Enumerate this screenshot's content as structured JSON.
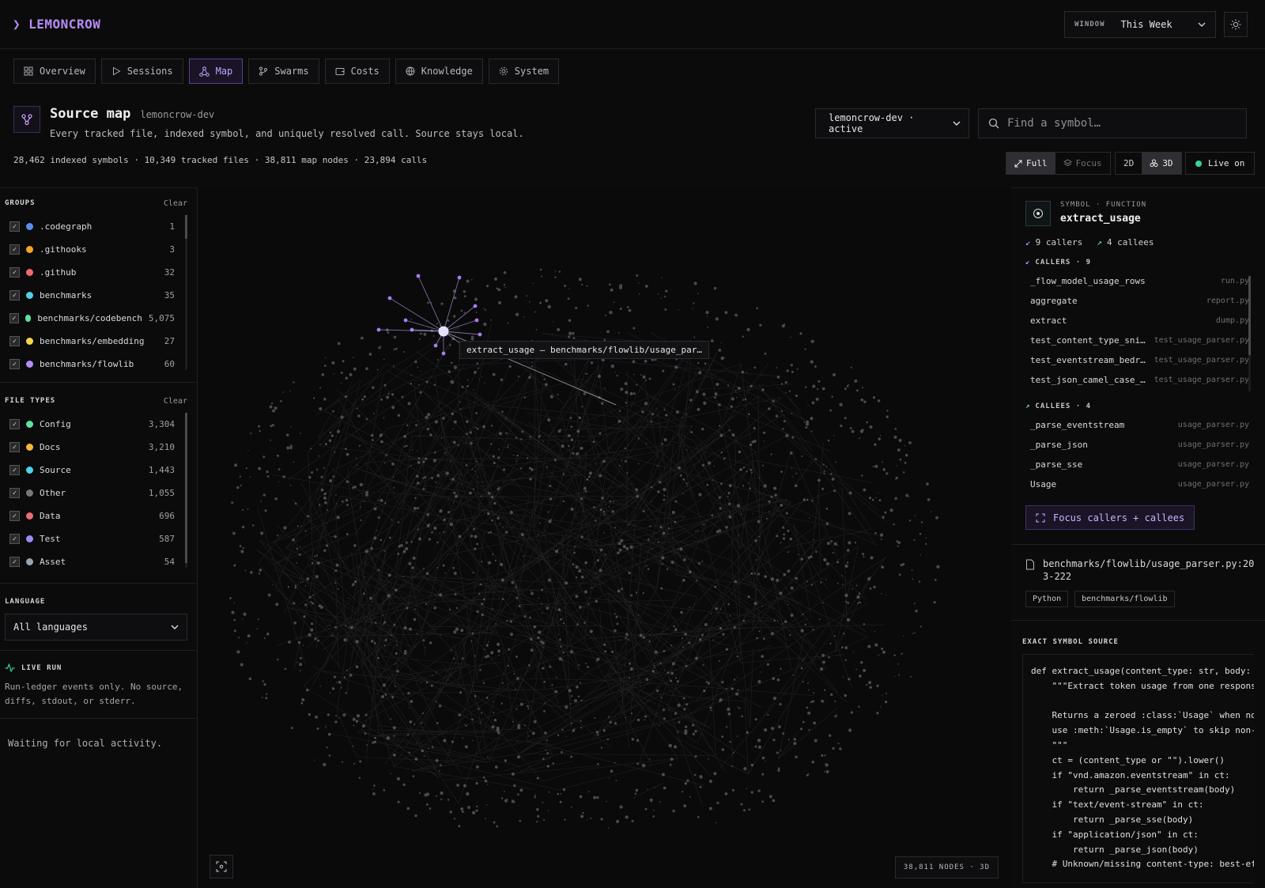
{
  "app": {
    "brand": "LEMONCROW"
  },
  "window": {
    "label": "WINDOW",
    "value": "This Week"
  },
  "tabs": [
    {
      "label": "Overview",
      "icon": "grid-icon"
    },
    {
      "label": "Sessions",
      "icon": "play-icon"
    },
    {
      "label": "Map",
      "icon": "graph-icon",
      "active": true
    },
    {
      "label": "Swarms",
      "icon": "branch-icon"
    },
    {
      "label": "Costs",
      "icon": "wallet-icon"
    },
    {
      "label": "Knowledge",
      "icon": "globe-icon"
    },
    {
      "label": "System",
      "icon": "gear-icon"
    }
  ],
  "header": {
    "title": "Source map",
    "project": "lemoncrow-dev",
    "description": "Every tracked file, indexed symbol, and uniquely resolved call. Source stays local.",
    "stats": "28,462 indexed symbols · 10,349 tracked files · 38,811 map nodes · 23,894 calls"
  },
  "project_select": {
    "value": "lemoncrow-dev · active"
  },
  "search": {
    "placeholder": "Find a symbol…"
  },
  "view": {
    "full": "Full",
    "focus": "Focus",
    "d2": "2D",
    "d3": "3D",
    "live": "Live on"
  },
  "groups": {
    "title": "GROUPS",
    "clear": "Clear",
    "items": [
      {
        "name": ".codegraph",
        "count": "1",
        "color": "#5b8def"
      },
      {
        "name": ".githooks",
        "count": "3",
        "color": "#f5a524"
      },
      {
        "name": ".github",
        "count": "32",
        "color": "#f06a6a"
      },
      {
        "name": "benchmarks",
        "count": "35",
        "color": "#4fd1e8"
      },
      {
        "name": "benchmarks/codebench",
        "count": "5,075",
        "color": "#5be39b"
      },
      {
        "name": "benchmarks/embedding",
        "count": "27",
        "color": "#f5d64a"
      },
      {
        "name": "benchmarks/flowlib",
        "count": "60",
        "color": "#b48df5"
      }
    ]
  },
  "file_types": {
    "title": "FILE TYPES",
    "clear": "Clear",
    "items": [
      {
        "name": "Config",
        "count": "3,304",
        "color": "#5be39b"
      },
      {
        "name": "Docs",
        "count": "3,210",
        "color": "#f5b83a"
      },
      {
        "name": "Source",
        "count": "1,443",
        "color": "#4fd1e8"
      },
      {
        "name": "Other",
        "count": "1,055",
        "color": "#777777"
      },
      {
        "name": "Data",
        "count": "696",
        "color": "#f06a7a"
      },
      {
        "name": "Test",
        "count": "587",
        "color": "#9a8cf5"
      },
      {
        "name": "Asset",
        "count": "54",
        "color": "#9aa4b0"
      }
    ]
  },
  "language": {
    "title": "LANGUAGE",
    "value": "All languages"
  },
  "live_run": {
    "title": "LIVE RUN",
    "text": "Run-ledger events only. No source, diffs, stdout, or stderr.",
    "status": "Waiting for local activity."
  },
  "map": {
    "tooltip": "extract_usage — benchmarks/flowlib/usage_par…",
    "nodes_badge": "38,811 NODES · 3D"
  },
  "symbol": {
    "kind": "SYMBOL · FUNCTION",
    "name": "extract_usage",
    "callers_count": "9 callers",
    "callees_count": "4 callees",
    "callers_title": "CALLERS · 9",
    "callers": [
      {
        "name": "_flow_model_usage_rows",
        "file": "run.py"
      },
      {
        "name": "aggregate",
        "file": "report.py"
      },
      {
        "name": "extract",
        "file": "dump.py"
      },
      {
        "name": "test_content_type_sni…",
        "file": "test_usage_parser.py"
      },
      {
        "name": "test_eventstream_bedr…",
        "file": "test_usage_parser.py"
      },
      {
        "name": "test_json_camel_case_…",
        "file": "test_usage_parser.py"
      }
    ],
    "callees_title": "CALLEES · 4",
    "callees": [
      {
        "name": "_parse_eventstream",
        "file": "usage_parser.py"
      },
      {
        "name": "_parse_json",
        "file": "usage_parser.py"
      },
      {
        "name": "_parse_sse",
        "file": "usage_parser.py"
      },
      {
        "name": "Usage",
        "file": "usage_parser.py"
      }
    ],
    "focus_button": "Focus callers + callees",
    "path_line1": "benchmarks/flowlib/usage_parser.py:20",
    "path_line2": "3-222",
    "tags": [
      "Python",
      "benchmarks/flowlib"
    ],
    "source_title": "EXACT SYMBOL SOURCE",
    "source": "def extract_usage(content_type: str, body: b\n    \"\"\"Extract token usage from one response\n\n    Returns a zeroed :class:`Usage` when no\n    use :meth:`Usage.is_empty` to skip non-m\n    \"\"\"\n    ct = (content_type or \"\").lower()\n    if \"vnd.amazon.eventstream\" in ct:\n        return _parse_eventstream(body)\n    if \"text/event-stream\" in ct:\n        return _parse_sse(body)\n    if \"application/json\" in ct:\n        return _parse_json(body)\n    # Unknown/missing content-type: best-eff"
  }
}
